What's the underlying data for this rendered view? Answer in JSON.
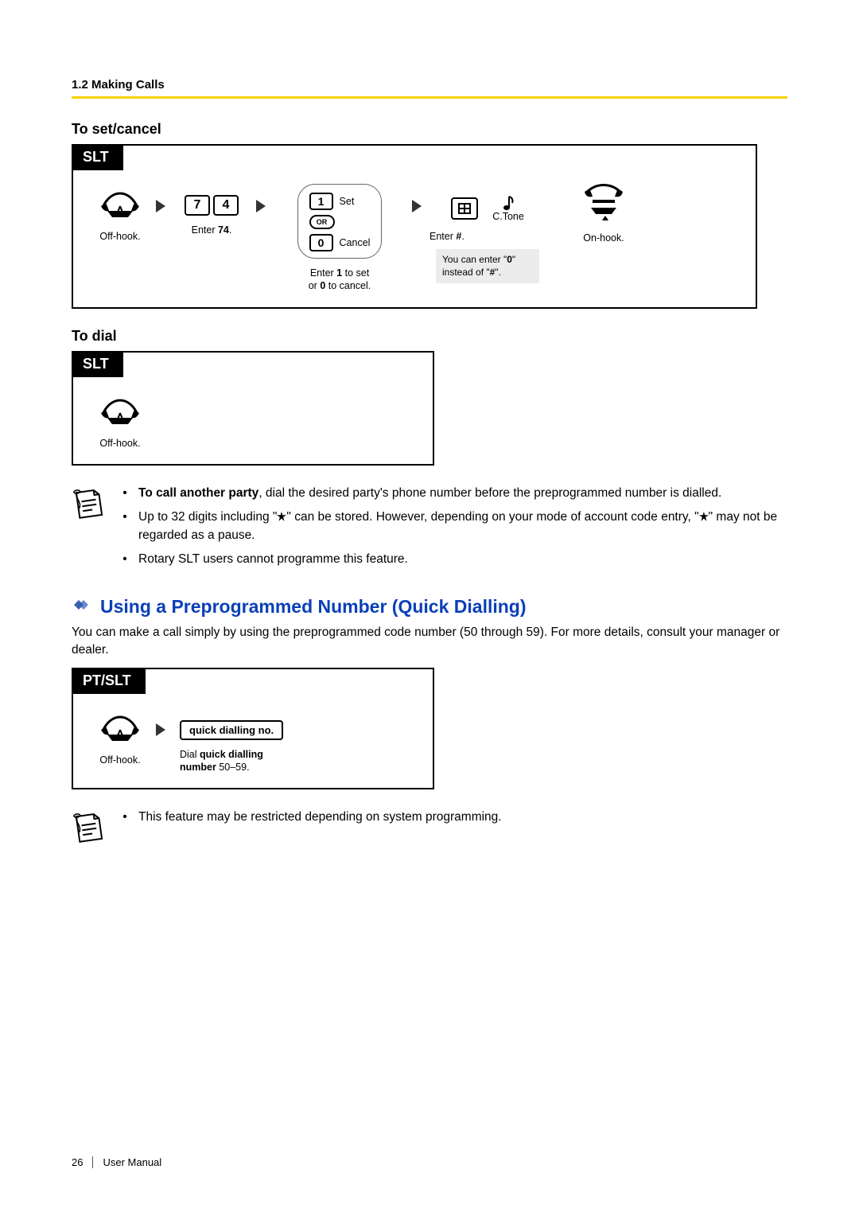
{
  "header": {
    "breadcrumb": "1.2 Making Calls"
  },
  "section1": {
    "title": "To set/cancel",
    "tab": "SLT",
    "step_offhook": "Off-hook.",
    "keys74": {
      "k1": "7",
      "k2": "4",
      "caption_prefix": "Enter ",
      "caption_bold": "74",
      "caption_suffix": "."
    },
    "options": {
      "set_key": "1",
      "set_label": "Set",
      "or_label": "OR",
      "cancel_key": "0",
      "cancel_label": "Cancel",
      "caption_line1_a": "Enter ",
      "caption_line1_b": "1",
      "caption_line1_c": " to set",
      "caption_line2_a": "or ",
      "caption_line2_b": "0",
      "caption_line2_c": " to cancel."
    },
    "hash": {
      "ctone": "C.Tone",
      "caption_a": "Enter ",
      "caption_b": "#",
      "caption_c": ".",
      "tip_a": "You can enter \"",
      "tip_b": "0",
      "tip_c": "\"\ninstead of \"",
      "tip_d": "#",
      "tip_e": "\"."
    },
    "step_onhook": "On-hook."
  },
  "section2": {
    "title": "To dial",
    "tab": "SLT",
    "step_offhook": "Off-hook."
  },
  "notes1": {
    "b1_bold": "To call another party",
    "b1_rest": ", dial the desired party's phone number before the preprogrammed number is dialled.",
    "b2_a": "Up to 32 digits including \"",
    "b2_b": "\" can be stored. However, depending on your mode of account code entry, \"",
    "b2_c": "\" may not be regarded as a pause.",
    "b3": "Rotary SLT users cannot programme this feature."
  },
  "feature": {
    "heading": "Using a Preprogrammed Number (Quick Dialling)",
    "intro": "You can make a call simply by using the preprogrammed code number (50 through 59). For more details, consult your manager or dealer."
  },
  "section3": {
    "tab": "PT/SLT",
    "step_offhook": "Off-hook.",
    "qd_label": "quick dialling no.",
    "caption_a": "Dial ",
    "caption_b": "quick dialling",
    "caption_c": "number",
    "caption_d": " 50–59."
  },
  "notes2": {
    "b1": "This feature may be restricted depending on system programming."
  },
  "footer": {
    "page": "26",
    "doc": "User Manual"
  }
}
